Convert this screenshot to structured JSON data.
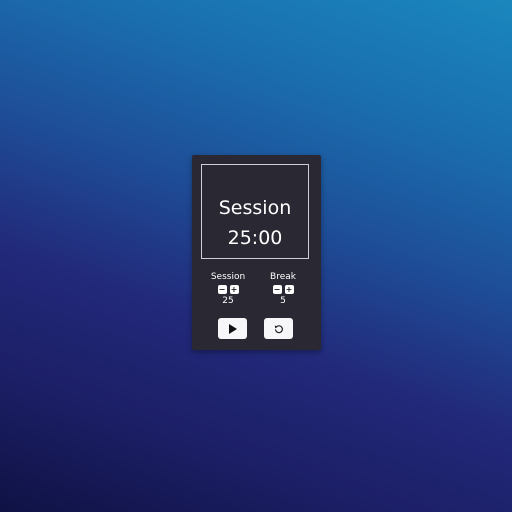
{
  "timer": {
    "mode": "Session",
    "time": "25:00"
  },
  "session": {
    "title": "Session",
    "value": "25",
    "decrement_icon": "minus-icon",
    "increment_icon": "plus-icon",
    "decrement_glyph": "−",
    "increment_glyph": "+"
  },
  "break": {
    "title": "Break",
    "value": "5",
    "decrement_icon": "minus-icon",
    "increment_icon": "plus-icon",
    "decrement_glyph": "−",
    "increment_glyph": "+"
  },
  "controls": {
    "play_icon": "play-icon",
    "reset_icon": "reset-icon"
  },
  "colors": {
    "card_background": "#2a2833",
    "background_top": "#1a87bd",
    "background_bottom": "#0f1244",
    "button_background": "#f7f7f9"
  }
}
